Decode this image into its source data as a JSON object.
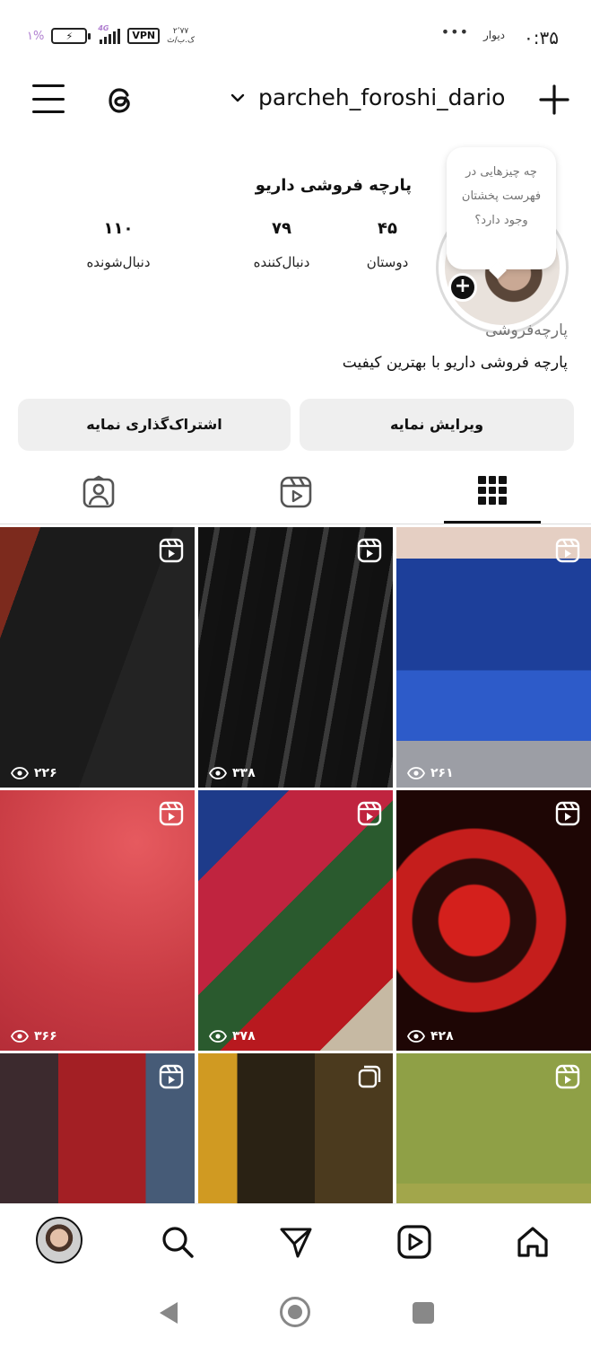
{
  "status_bar": {
    "time": "۰:۳۵",
    "app_label": "دیوار",
    "dots": "•••",
    "battery_percent": "۱%",
    "battery_icon": "battery-charging-icon",
    "network_label": "4G",
    "vpn_label": "VPN",
    "speed_value": "۲٬۷۷",
    "speed_unit": "ک.ب/ث"
  },
  "top_bar": {
    "username": "parcheh_foroshi_dario",
    "menu_icon": "hamburger-menu-icon",
    "threads_icon": "threads-icon",
    "create_icon": "plus-icon"
  },
  "profile": {
    "display_name": "پارچه فروشی داریو",
    "note_text": "چه چیزهایی در فهرست پخشتان وجود دارد؟",
    "stats": [
      {
        "value": "۴۵",
        "label": "دوستان"
      },
      {
        "value": "۷۹",
        "label": "دنبال‌کننده"
      },
      {
        "value": "۱۱۰",
        "label": "دنبال‌شونده"
      }
    ],
    "category": "پارچه‌فروشی",
    "bio": "پارچه فروشی داریو با بهترین کیفیت",
    "edit_button": "ویرایش نمایه",
    "share_button": "اشتراک‌گذاری نمایه"
  },
  "tabs": {
    "active": "grid",
    "grid_icon": "grid-icon",
    "reels_icon": "reels-icon",
    "tagged_icon": "tagged-person-icon"
  },
  "posts": [
    {
      "views": "۲۲۶",
      "type": "reel"
    },
    {
      "views": "۳۳۸",
      "type": "reel"
    },
    {
      "views": "۲۶۱",
      "type": "reel"
    },
    {
      "views": "۳۶۶",
      "type": "reel"
    },
    {
      "views": "۳۷۸",
      "type": "reel"
    },
    {
      "views": "۴۲۸",
      "type": "reel"
    },
    {
      "views": "",
      "type": "reel"
    },
    {
      "views": "",
      "type": "carousel"
    },
    {
      "views": "",
      "type": "reel"
    }
  ],
  "bottom_nav": {
    "items": [
      "profile-avatar",
      "search-icon",
      "send-icon",
      "reels-icon",
      "home-icon"
    ]
  },
  "colors": {
    "accent": "#111111",
    "button_bg": "#efefef",
    "muted_text": "#737373"
  }
}
